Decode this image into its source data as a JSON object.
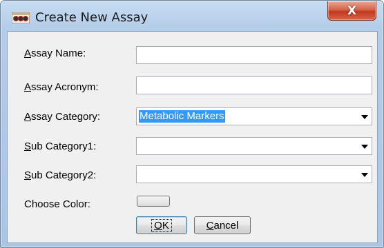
{
  "window": {
    "title": "Create New Assay",
    "close_label": "X"
  },
  "form": {
    "assay_name": {
      "mnemonic": "A",
      "rest": "ssay Name:",
      "value": ""
    },
    "assay_acronym": {
      "mnemonic": "A",
      "rest": "ssay Acronym:",
      "value": ""
    },
    "assay_category": {
      "mnemonic": "A",
      "rest": "ssay Category:",
      "value": "Metabolic Markers"
    },
    "sub_category1": {
      "mnemonic": "S",
      "rest": "ub Category1:",
      "value": ""
    },
    "sub_category2": {
      "mnemonic": "S",
      "rest": "ub Category2:",
      "value": ""
    },
    "choose_color": {
      "label": "Choose Color:"
    }
  },
  "buttons": {
    "ok": {
      "mnemonic": "O",
      "rest": "K"
    },
    "cancel": {
      "mnemonic": "C",
      "rest": "ancel"
    }
  },
  "colors": {
    "selection": "#3399ff",
    "close_button": "#c2391f",
    "dialog_bg": "#f0f0f0",
    "frame": "#b4cde8"
  },
  "icons": {
    "app": "assay-app-icon",
    "close": "close-icon",
    "dropdown": "chevron-down-icon"
  }
}
